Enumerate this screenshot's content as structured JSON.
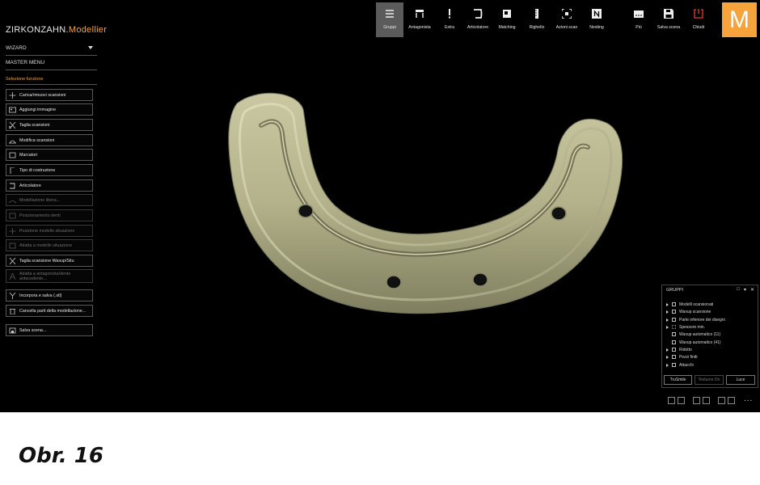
{
  "app": {
    "brand_main": "ZIRKONZAHN.",
    "brand_accent": "Modellier",
    "logo_letter": "M",
    "accent_color": "#f5a33a"
  },
  "sidebar": {
    "wizard_label": "WIZARD",
    "master_menu_label": "MASTER MENU",
    "section_title": "Selezione funzione",
    "functions": [
      {
        "label": "Carica/rimuovi scansioni",
        "icon": "upload-icon",
        "enabled": true
      },
      {
        "label": "Aggiungi immagine",
        "icon": "image-icon",
        "enabled": true
      },
      {
        "label": "Taglia scansioni",
        "icon": "scissors-icon",
        "enabled": true
      },
      {
        "label": "Modifica scansioni",
        "icon": "edit-scan-icon",
        "enabled": true
      },
      {
        "label": "Marcatori",
        "icon": "marker-icon",
        "enabled": true
      },
      {
        "label": "Tipo di costruzione",
        "icon": "construction-type-icon",
        "enabled": true
      },
      {
        "label": "Articolatore",
        "icon": "articulator-icon",
        "enabled": true
      },
      {
        "label": "Modellazione libera...",
        "icon": "free-model-icon",
        "enabled": false
      },
      {
        "label": "Posizionamento denti",
        "icon": "teeth-position-icon",
        "enabled": false
      },
      {
        "label": "Posizione modello situazione",
        "icon": "move-icon",
        "enabled": false
      },
      {
        "label": "Adatta a modello situazione",
        "icon": "adapt-icon",
        "enabled": false
      },
      {
        "label": "Taglia scansione Waxup/Situ",
        "icon": "scissors-icon",
        "enabled": true
      },
      {
        "label": "Adatta a antagonista/dente antecedente...",
        "icon": "letter-a-icon",
        "enabled": false
      },
      {
        "label": "Incorpora e salva (.stl)",
        "icon": "merge-icon",
        "enabled": true
      },
      {
        "label": "Cancella parti della modellazione...",
        "icon": "trash-icon",
        "enabled": true
      },
      {
        "label": "Salva scena...",
        "icon": "save-scene-icon",
        "enabled": true
      }
    ]
  },
  "toolbar": {
    "tools": [
      {
        "label": "Gruppi",
        "icon": "groups-icon",
        "active": true
      },
      {
        "label": "Antagonista",
        "icon": "antagonist-icon",
        "active": false
      },
      {
        "label": "Extra",
        "icon": "extra-icon",
        "active": false
      },
      {
        "label": "Articolatore",
        "icon": "articulator-icon",
        "active": false
      },
      {
        "label": "Matching",
        "icon": "matching-icon",
        "active": false
      },
      {
        "label": "Righello",
        "icon": "ruler-icon",
        "active": false
      },
      {
        "label": "Azioni scan",
        "icon": "scan-actions-icon",
        "active": false
      },
      {
        "label": "Nesting",
        "icon": "nesting-icon",
        "active": false
      },
      {
        "label": "Più",
        "icon": "more-icon",
        "active": false
      },
      {
        "label": "Salva scena",
        "icon": "save-icon",
        "active": false
      },
      {
        "label": "Chiudi",
        "icon": "power-icon",
        "active": false
      }
    ]
  },
  "groups_panel": {
    "title": "GRUPPI",
    "items": [
      {
        "label": "Modelli scansionati",
        "expandable": true,
        "checkbox": "box"
      },
      {
        "label": "Waxup scansione",
        "expandable": true,
        "checkbox": "box"
      },
      {
        "label": "Parte inferiore dei disegni",
        "expandable": true,
        "checkbox": "box"
      },
      {
        "label": "Spessore min.",
        "expandable": true,
        "checkbox": "dotted"
      },
      {
        "label": "Waxup automatico (11)",
        "expandable": false,
        "checkbox": "box"
      },
      {
        "label": "Waxup automatico (41)",
        "expandable": false,
        "checkbox": "box"
      },
      {
        "label": "Ridotto",
        "expandable": true,
        "checkbox": "box"
      },
      {
        "label": "Pezzi finiti",
        "expandable": true,
        "checkbox": "box"
      },
      {
        "label": "Attacchi",
        "expandable": true,
        "checkbox": "box"
      }
    ],
    "btn_trusmile": "TruSmile",
    "btn_textures": "Textures On",
    "btn_luce": "Luce"
  },
  "bottom": {
    "more_label": "..."
  },
  "caption": "Obr. 16"
}
